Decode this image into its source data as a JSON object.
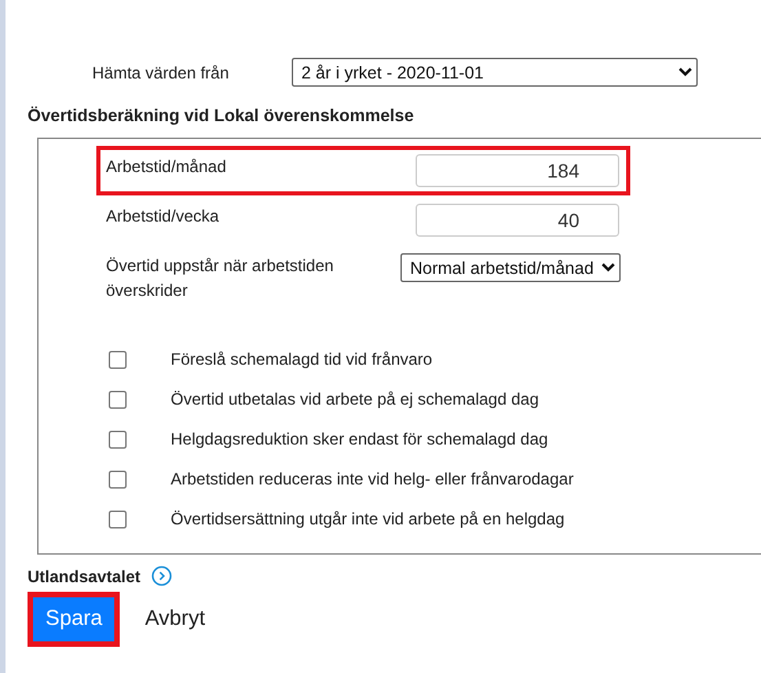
{
  "source": {
    "label": "Hämta värden från",
    "value": "2 år i yrket - 2020-11-01"
  },
  "section_title": "Övertidsberäkning vid Lokal överenskommelse",
  "fields": [
    {
      "kind": "number",
      "label": "Arbetstid/månad",
      "value": "184",
      "highlighted": true
    },
    {
      "kind": "number",
      "label": "Arbetstid/vecka",
      "value": "40",
      "highlighted": false
    },
    {
      "kind": "select",
      "label": "Övertid uppstår när arbetstiden överskrider",
      "value": "Normal arbetstid/månad",
      "highlighted": false
    }
  ],
  "options": [
    {
      "label": "Föreslå schemalagd tid vid frånvaro",
      "checked": false
    },
    {
      "label": "Övertid utbetalas vid arbete på ej schemalagd dag",
      "checked": false
    },
    {
      "label": "Helgdagsreduktion sker endast för schemalagd dag",
      "checked": false
    },
    {
      "label": "Arbetstiden reduceras inte vid helg- eller frånvarodagar",
      "checked": false
    },
    {
      "label": "Övertidsersättning utgår inte vid arbete på en helgdag",
      "checked": false
    }
  ],
  "expander": {
    "label": "Utlandsavtalet"
  },
  "buttons": [
    {
      "kind": "primary",
      "label": "Spara",
      "highlighted": true
    },
    {
      "kind": "link",
      "label": "Avbryt",
      "highlighted": false
    }
  ]
}
